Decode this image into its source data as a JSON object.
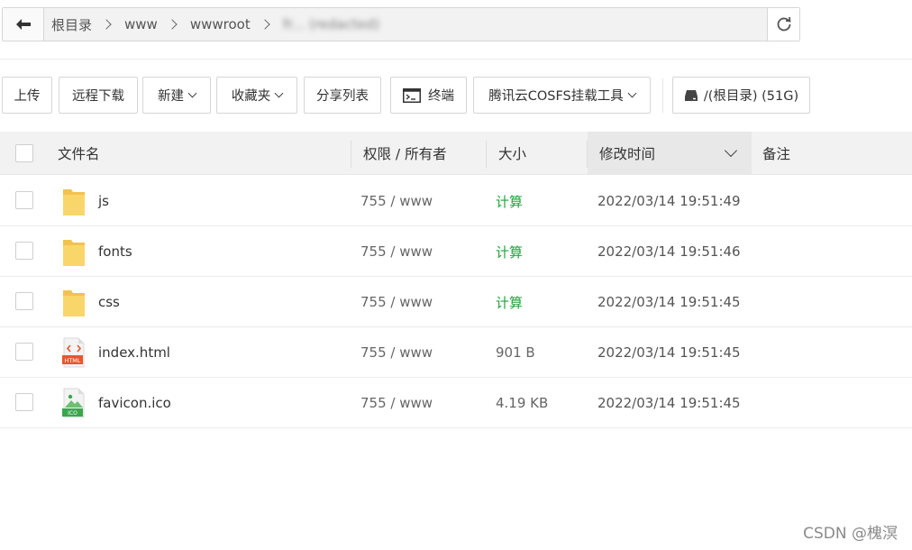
{
  "path": {
    "crumbs": [
      "根目录",
      "www",
      "wwwroot"
    ],
    "current": "fr... (redacted)"
  },
  "toolbar": {
    "upload": "上传",
    "remote_download": "远程下载",
    "new": "新建",
    "favorites": "收藏夹",
    "share_list": "分享列表",
    "terminal": "终端",
    "cosfs": "腾讯云COSFS挂载工具",
    "disk": "/(根目录) (51G)"
  },
  "table": {
    "headers": {
      "name": "文件名",
      "perm": "权限 / 所有者",
      "size": "大小",
      "mtime": "修改时间",
      "note": "备注"
    },
    "rows": [
      {
        "name": "js",
        "perm": "755 / www",
        "size": "计算",
        "mtime": "2022/03/14 19:51:49",
        "type": "folder"
      },
      {
        "name": "fonts",
        "perm": "755 / www",
        "size": "计算",
        "mtime": "2022/03/14 19:51:46",
        "type": "folder"
      },
      {
        "name": "css",
        "perm": "755 / www",
        "size": "计算",
        "mtime": "2022/03/14 19:51:45",
        "type": "folder"
      },
      {
        "name": "index.html",
        "perm": "755 / www",
        "size": "901 B",
        "mtime": "2022/03/14 19:51:45",
        "type": "html"
      },
      {
        "name": "favicon.ico",
        "perm": "755 / www",
        "size": "4.19 KB",
        "mtime": "2022/03/14 19:51:45",
        "type": "ico"
      }
    ]
  },
  "icons": {
    "html_label": "HTML",
    "ico_label": "ICO"
  },
  "colors": {
    "accent_green": "#20a53a",
    "folder": "#f7cf5d",
    "html_badge": "#e8572a",
    "ico_badge": "#3aa64c"
  },
  "watermark": "CSDN @槐溟"
}
